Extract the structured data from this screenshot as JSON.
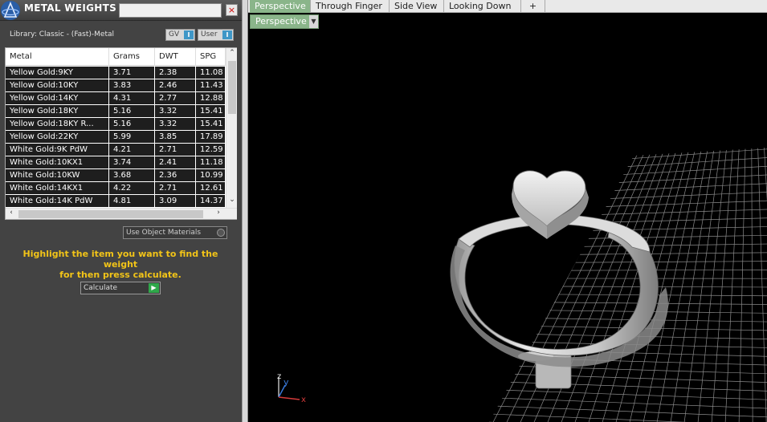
{
  "panel": {
    "title": "METAL WEIGHTS",
    "close_label": "×",
    "library_label": "Library: Classic - (Fast)-Metal",
    "toggles": {
      "gv": "GV",
      "user": "User",
      "indicator": "I"
    },
    "table": {
      "columns": [
        "Metal",
        "Grams",
        "DWT",
        "SPG"
      ],
      "rows": [
        [
          "Yellow Gold:9KY",
          "3.71",
          "2.38",
          "11.08"
        ],
        [
          "Yellow Gold:10KY",
          "3.83",
          "2.46",
          "11.43"
        ],
        [
          "Yellow Gold:14KY",
          "4.31",
          "2.77",
          "12.88"
        ],
        [
          "Yellow Gold:18KY",
          "5.16",
          "3.32",
          "15.41"
        ],
        [
          "Yellow Gold:18KY R...",
          "5.16",
          "3.32",
          "15.41"
        ],
        [
          "Yellow Gold:22KY",
          "5.99",
          "3.85",
          "17.89"
        ],
        [
          "White Gold:9K PdW",
          "4.21",
          "2.71",
          "12.59"
        ],
        [
          "White Gold:10KX1",
          "3.74",
          "2.41",
          "11.18"
        ],
        [
          "White Gold:10KW",
          "3.68",
          "2.36",
          "10.99"
        ],
        [
          "White Gold:14KX1",
          "4.22",
          "2.71",
          "12.61"
        ],
        [
          "White Gold:14K PdW",
          "4.81",
          "3.09",
          "14.37"
        ]
      ]
    },
    "use_object_materials": "Use Object Materials",
    "instruction_line1": "Highlight the item you want to find the weight",
    "instruction_line2": "for then press calculate.",
    "calculate_label": "Calculate"
  },
  "viewport": {
    "tabs": [
      "Perspective",
      "Through Finger",
      "Side View",
      "Looking Down"
    ],
    "active_tab": "Perspective",
    "add_tab_label": "+",
    "view_dropdown": "Perspective",
    "axes": {
      "x": "x",
      "y": "y",
      "z": "z"
    },
    "colors": {
      "tab_active": "#8ab58a",
      "axis_x": "#d43a3a",
      "axis_y": "#3b7de0",
      "axis_z": "#e9e9e9",
      "instruction": "#f2c418"
    }
  }
}
